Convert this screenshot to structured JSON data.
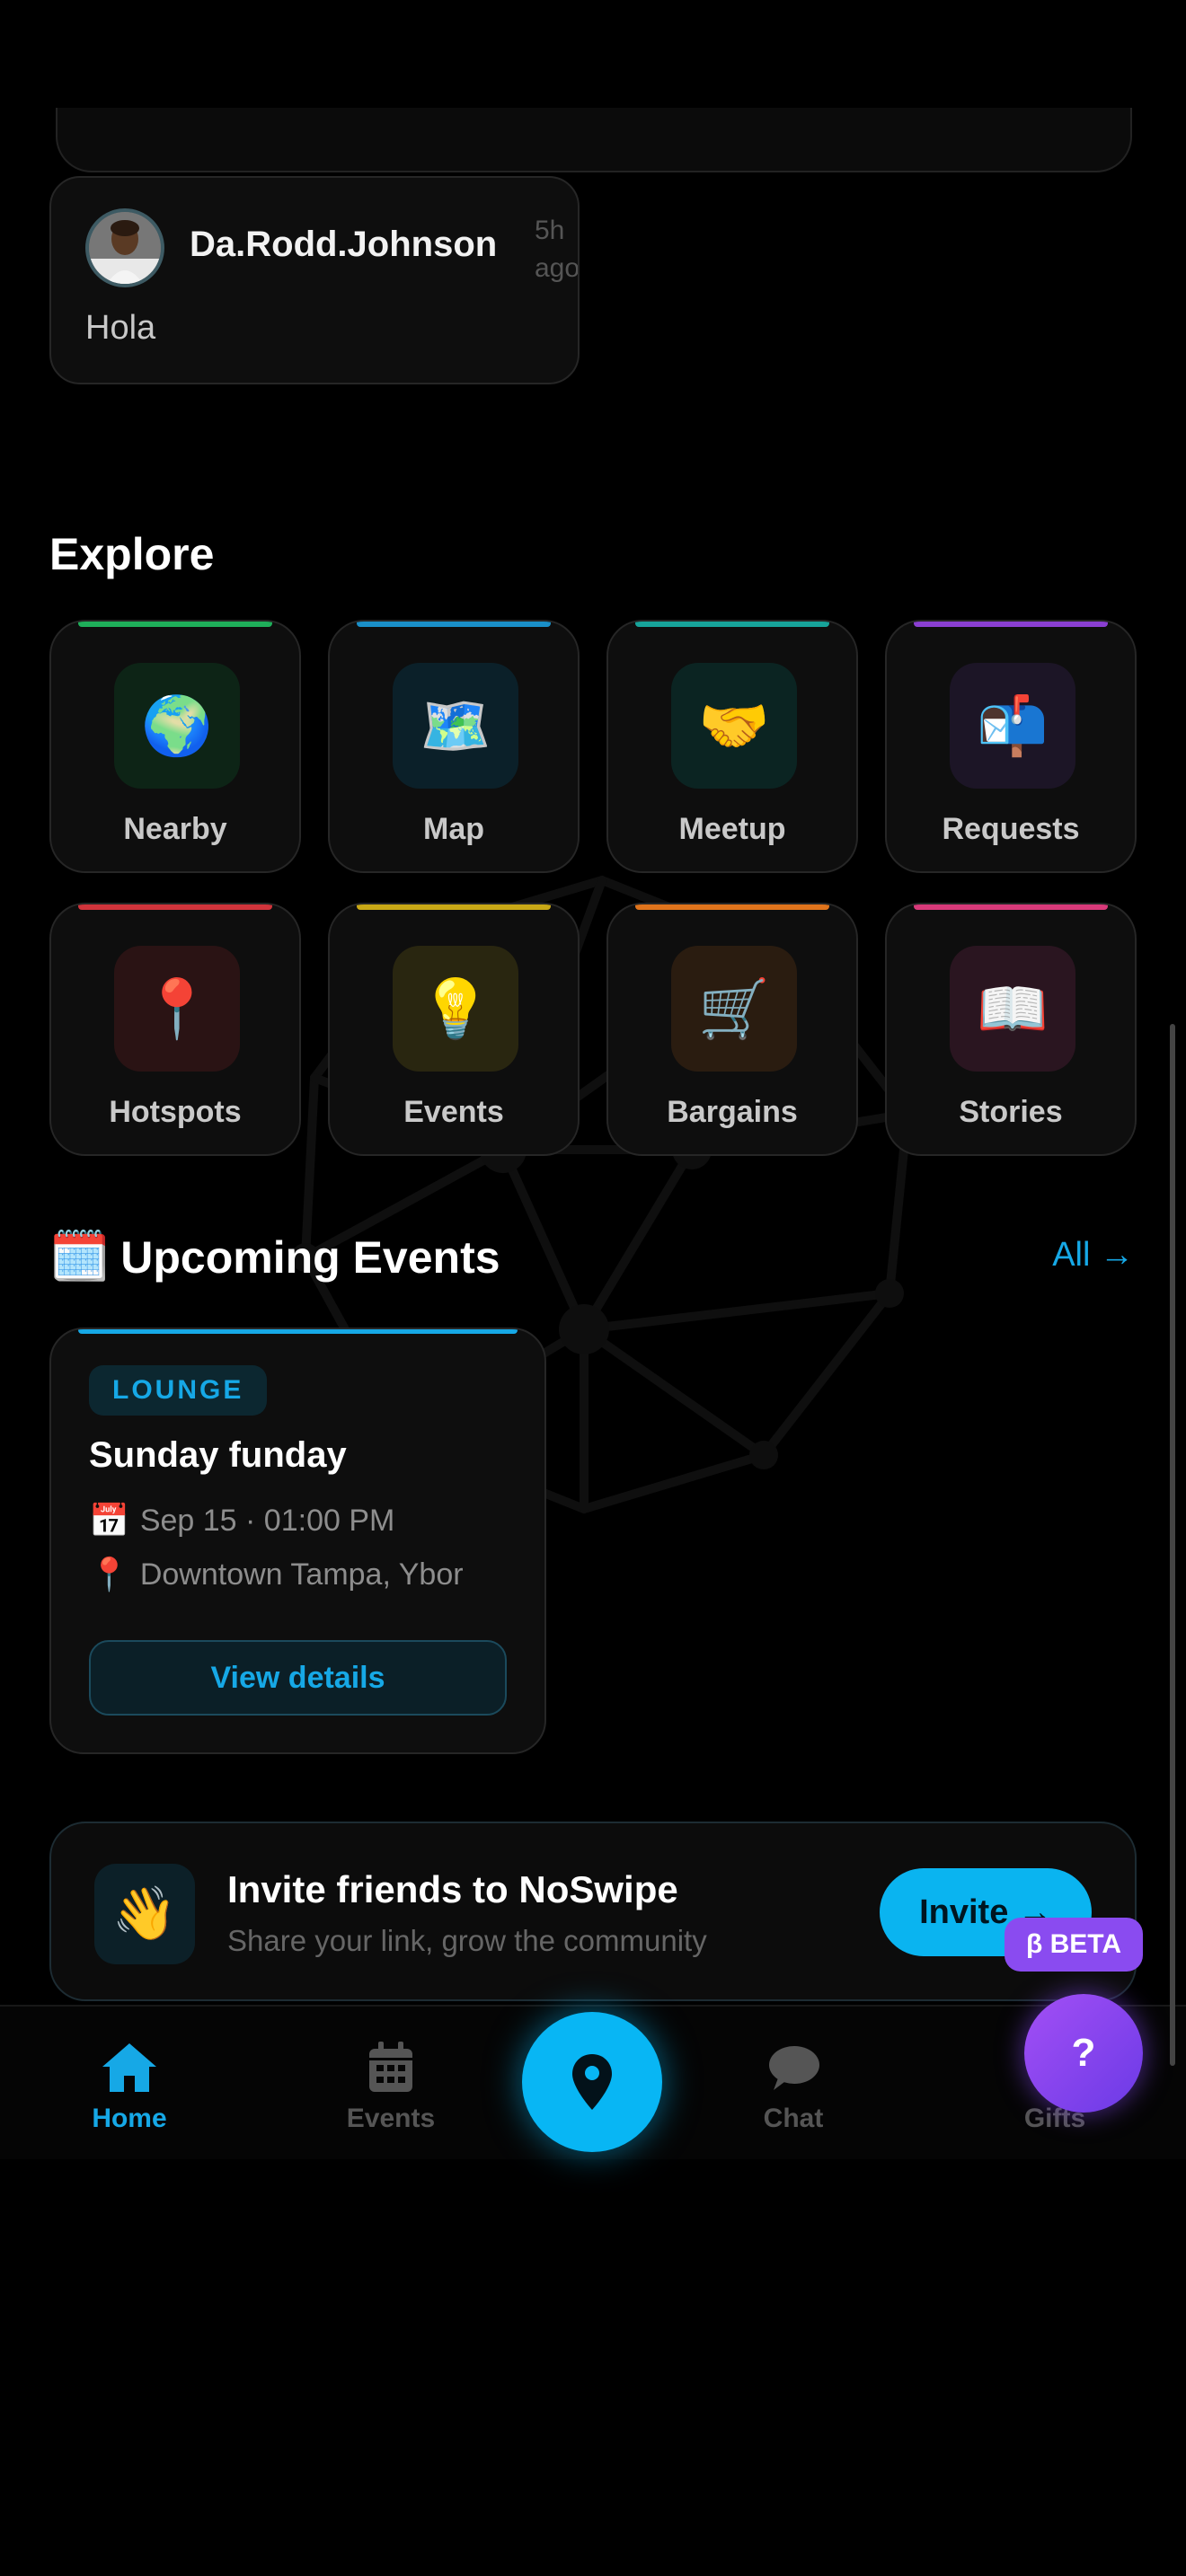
{
  "comment": {
    "user": "Da.Rodd.Johnson",
    "time": "5h ago",
    "text": "Hola"
  },
  "explore": {
    "title": "Explore",
    "tiles": [
      {
        "label": "Nearby",
        "icon": "globe-icon",
        "glyph": "🌍",
        "accent": "#1fae5a",
        "box": "#0d2416"
      },
      {
        "label": "Map",
        "icon": "map-icon",
        "glyph": "🗺️",
        "accent": "#1a8fc8",
        "box": "#0b2029"
      },
      {
        "label": "Meetup",
        "icon": "handshake-icon",
        "glyph": "🤝",
        "accent": "#17a39a",
        "box": "#0b2422"
      },
      {
        "label": "Requests",
        "icon": "mailbox-icon",
        "glyph": "📬",
        "accent": "#8a3fd1",
        "box": "#1c1526"
      },
      {
        "label": "Hotspots",
        "icon": "pushpin-icon",
        "glyph": "📍",
        "accent": "#d0343b",
        "box": "#2a1314"
      },
      {
        "label": "Events",
        "icon": "lightbulb-icon",
        "glyph": "💡",
        "accent": "#c9a816",
        "box": "#292610"
      },
      {
        "label": "Bargains",
        "icon": "cart-icon",
        "glyph": "🛒",
        "accent": "#e0741c",
        "box": "#2a1c10"
      },
      {
        "label": "Stories",
        "icon": "book-icon",
        "glyph": "📖",
        "accent": "#d83a7a",
        "box": "#2a1520"
      }
    ]
  },
  "upcoming": {
    "icon": "🗓️",
    "title": "Upcoming Events",
    "all_link": "All →"
  },
  "event": {
    "badge": "LOUNGE",
    "title": "Sunday funday",
    "date_icon": "📅",
    "date": "Sep 15 · 01:00 PM",
    "location_icon": "📍",
    "location": "Downtown Tampa, Ybor",
    "button": "View details"
  },
  "invite": {
    "icon": "👋",
    "title": "Invite friends to NoSwipe",
    "subtitle": "Share your link, grow the community",
    "button": "Invite →"
  },
  "nav": {
    "home": "Home",
    "events": "Events",
    "chat": "Chat",
    "gifts": "Gifts"
  },
  "beta": "β BETA",
  "help": "?",
  "colors": {
    "accent": "#16a8e6",
    "beta": "#8a4bf0"
  }
}
